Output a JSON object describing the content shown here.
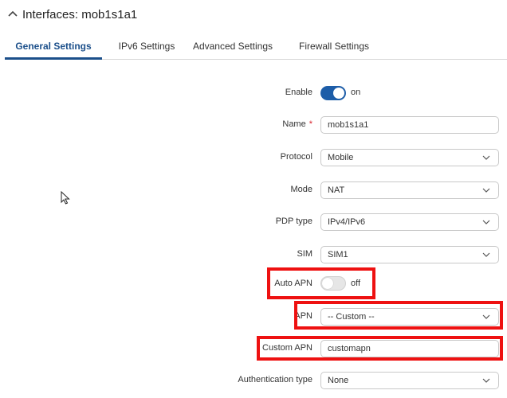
{
  "header": {
    "title": "Interfaces: mob1s1a1"
  },
  "tabs": [
    {
      "label": "General Settings"
    },
    {
      "label": "IPv6 Settings"
    },
    {
      "label": "Advanced Settings"
    },
    {
      "label": "Firewall Settings"
    }
  ],
  "form": {
    "enable": {
      "label": "Enable",
      "state": "on"
    },
    "name": {
      "label": "Name",
      "required": "*",
      "value": "mob1s1a1"
    },
    "protocol": {
      "label": "Protocol",
      "value": "Mobile"
    },
    "mode": {
      "label": "Mode",
      "value": "NAT"
    },
    "pdp_type": {
      "label": "PDP type",
      "value": "IPv4/IPv6"
    },
    "sim": {
      "label": "SIM",
      "value": "SIM1"
    },
    "auto_apn": {
      "label": "Auto APN",
      "state": "off"
    },
    "apn": {
      "label": "APN",
      "value": "-- Custom --"
    },
    "custom_apn": {
      "label": "Custom APN",
      "value": "customapn"
    },
    "auth_type": {
      "label": "Authentication type",
      "value": "None"
    }
  },
  "colors": {
    "accent": "#1d5da8",
    "highlight": "#ee1111",
    "required": "#d8262f"
  }
}
